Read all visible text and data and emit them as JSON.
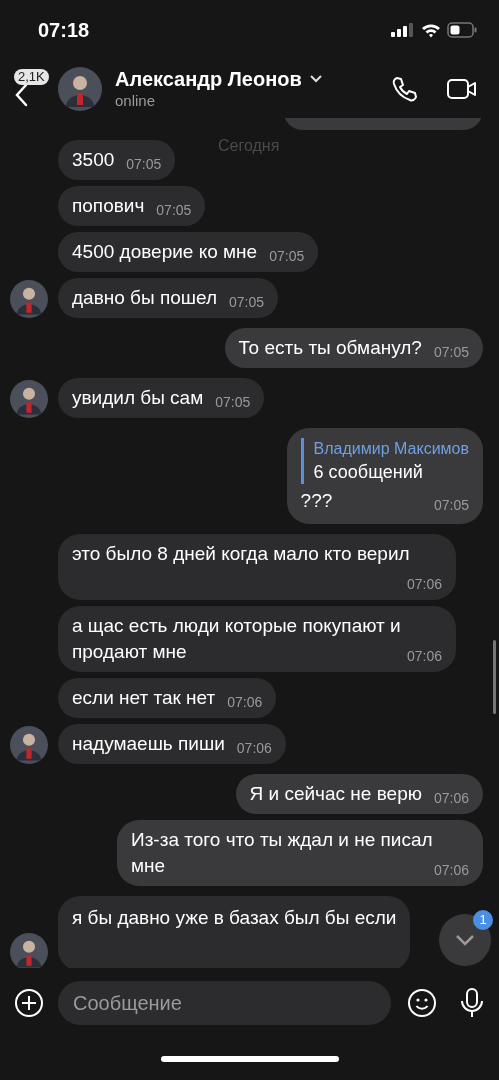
{
  "status_bar": {
    "time": "07:18"
  },
  "header": {
    "back_badge": "2,1K",
    "name": "Александр Леонов",
    "status": "online"
  },
  "date_label": "Сегодня",
  "messages": [
    {
      "kind": "partial",
      "outgoing": true
    },
    {
      "kind": "text",
      "outgoing": false,
      "avatar": false,
      "text": "3500",
      "time": "07:05"
    },
    {
      "kind": "text",
      "outgoing": false,
      "avatar": false,
      "text": "попович",
      "time": "07:05"
    },
    {
      "kind": "text",
      "outgoing": false,
      "avatar": false,
      "text": "4500 доверие ко мне",
      "time": "07:05"
    },
    {
      "kind": "text",
      "outgoing": false,
      "avatar": true,
      "text": "давно бы пошел",
      "time": "07:05"
    },
    {
      "kind": "text",
      "outgoing": true,
      "text": "То есть ты обманул?",
      "time": "07:05"
    },
    {
      "kind": "text",
      "outgoing": false,
      "avatar": true,
      "text": "увидил бы сам",
      "time": "07:05"
    },
    {
      "kind": "reply",
      "outgoing": true,
      "reply_author": "Владимир Максимов",
      "reply_text": "6 сообщений",
      "text": "???",
      "time": "07:05"
    },
    {
      "kind": "text",
      "outgoing": false,
      "avatar": false,
      "text": "это было 8 дней когда мало кто верил",
      "time": "07:06"
    },
    {
      "kind": "text",
      "outgoing": false,
      "avatar": false,
      "text": "а щас есть люди которые покупают и продают мне",
      "time": "07:06"
    },
    {
      "kind": "text",
      "outgoing": false,
      "avatar": false,
      "text": "если нет так нет",
      "time": "07:06"
    },
    {
      "kind": "text",
      "outgoing": false,
      "avatar": true,
      "text": "надумаешь пиши",
      "time": "07:06"
    },
    {
      "kind": "text",
      "outgoing": true,
      "text": "Я и сейчас не верю",
      "time": "07:06"
    },
    {
      "kind": "text",
      "outgoing": true,
      "text": "Из-за того что ты ждал и не писал мне",
      "time": "07:06"
    },
    {
      "kind": "cut",
      "outgoing": false,
      "avatar": true,
      "text": "я бы давно уже в базах был бы если"
    }
  ],
  "scroll_button": {
    "badge": "1"
  },
  "composer": {
    "placeholder": "Сообщение"
  }
}
